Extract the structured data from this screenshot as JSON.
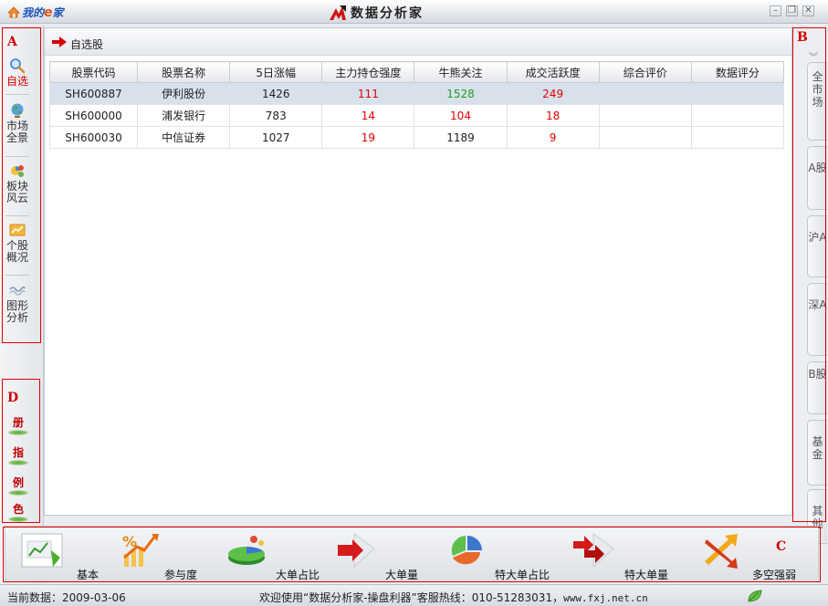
{
  "window": {
    "brand": {
      "pre": "我的",
      "e": "e",
      "post": "家"
    },
    "title": "数据分析家",
    "controls": {
      "minimize": "–",
      "restore": "❐",
      "close": "✕"
    }
  },
  "sidebar": {
    "items": [
      {
        "label": "自选",
        "icon": "magnifier-icon",
        "active": true
      },
      {
        "label": "市场全景",
        "icon": "globe-icon"
      },
      {
        "label": "板块风云",
        "icon": "pie-chart-icon"
      },
      {
        "label": "个股概况",
        "icon": "stock-chart-icon"
      },
      {
        "label": "图形分析",
        "icon": "wave-chart-icon"
      }
    ],
    "tools": [
      "册",
      "指",
      "例",
      "色"
    ]
  },
  "labels": {
    "a": "A",
    "b": "B",
    "c": "C",
    "d": "D"
  },
  "panel": {
    "title": "自选股"
  },
  "table": {
    "columns": [
      "股票代码",
      "股票名称",
      "5日涨幅",
      "主力持仓强度",
      "牛熊关注",
      "成交活跃度",
      "综合评价",
      "数据评分"
    ],
    "rows": [
      [
        "SH600887",
        "伊利股份",
        "1426",
        "111",
        "1528",
        "249",
        "",
        ""
      ],
      [
        "SH600000",
        "浦发银行",
        "783",
        "14",
        "104",
        "18",
        "",
        ""
      ],
      [
        "SH600030",
        "中信证券",
        "1027",
        "19",
        "1189",
        "9",
        "",
        ""
      ]
    ],
    "selected_row": 0
  },
  "right_tabs": [
    {
      "label": "全市场"
    },
    {
      "label": "A股"
    },
    {
      "label": "沪A"
    },
    {
      "label": "深A"
    },
    {
      "label": "B股"
    },
    {
      "label": "基金"
    },
    {
      "label": "其他"
    }
  ],
  "toolbar": {
    "buttons": [
      {
        "label": "基本",
        "icon": "chart-document-icon"
      },
      {
        "label": "参与度",
        "icon": "percent-growth-icon"
      },
      {
        "label": "大单占比",
        "icon": "pie-3d-icon"
      },
      {
        "label": "大单量",
        "icon": "red-arrow-icon"
      },
      {
        "label": "特大单占比",
        "icon": "pie-exploded-icon"
      },
      {
        "label": "特大单量",
        "icon": "double-arrow-icon"
      },
      {
        "label": "多空强弱",
        "icon": "crossed-arrows-icon"
      }
    ]
  },
  "status": {
    "date": "当前数据：2009-03-06",
    "welcome": "欢迎使用“数据分析家-操盘利器”客服热线：010-51283031，",
    "url": "www.fxj.net.cn"
  },
  "colors": {
    "accent_red": "#e00000",
    "positive_green": "#20a020",
    "selected_row": "#d8e0ec"
  }
}
